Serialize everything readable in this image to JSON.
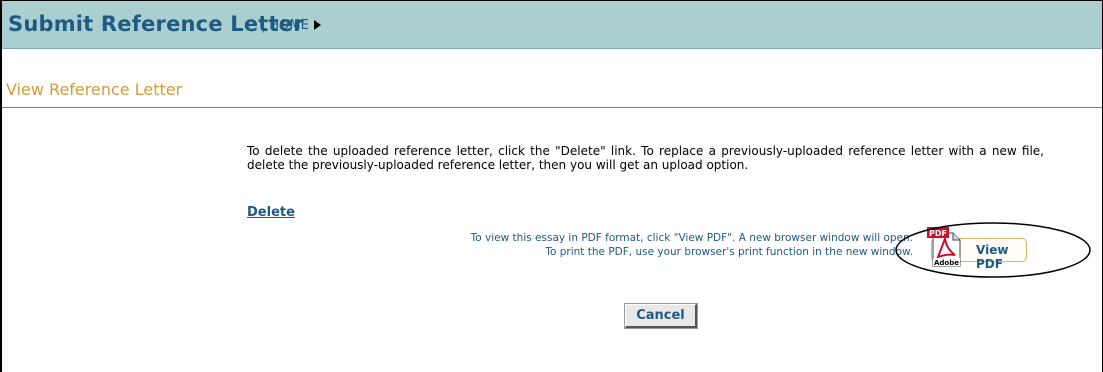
{
  "header": {
    "app_title": "Submit Reference Letter",
    "separator": "|",
    "home_label": "HOME",
    "background": "#a9cfd1",
    "title_color": "#1f5a82"
  },
  "section": {
    "title": "View Reference Letter",
    "title_color": "#d39b3a"
  },
  "main": {
    "instructions": "To delete the uploaded reference letter, click the \"Delete\" link. To replace a previously-uploaded reference letter with a new file, delete the previously-uploaded reference letter, then you will get an upload option.",
    "delete_link": "Delete",
    "pdf_note_line1": "To view this essay in PDF format, click \"View PDF\". A new browser window will open.",
    "pdf_note_line2": "To print the PDF, use your browser's print function in the new window.",
    "view_pdf_label": "View PDF",
    "pdf_icon_badge": "PDF",
    "pdf_icon_brand": "Adobe",
    "cancel_label": "Cancel"
  },
  "icons": {
    "home_arrow": "triangle-right-icon",
    "pdf": "adobe-pdf-icon"
  }
}
